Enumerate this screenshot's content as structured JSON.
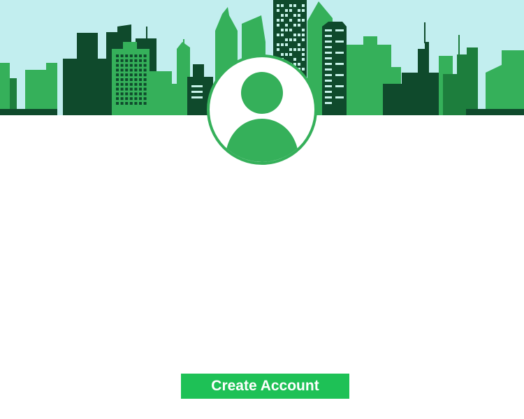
{
  "colors": {
    "sky": "#c2eeef",
    "building_light": "#35b05a",
    "building_mid": "#1d7e3d",
    "building_dark": "#0f4a2c",
    "window": "#c6f2e8",
    "avatar_border": "#35b05a",
    "avatar_figure": "#35b05a",
    "button_bg": "#1ec156",
    "button_text": "#ffffff"
  },
  "header": {
    "illustration": "city-skyline-illustration"
  },
  "profile": {
    "avatar_icon": "user-avatar-icon"
  },
  "actions": {
    "create_account_label": "Create Account"
  }
}
